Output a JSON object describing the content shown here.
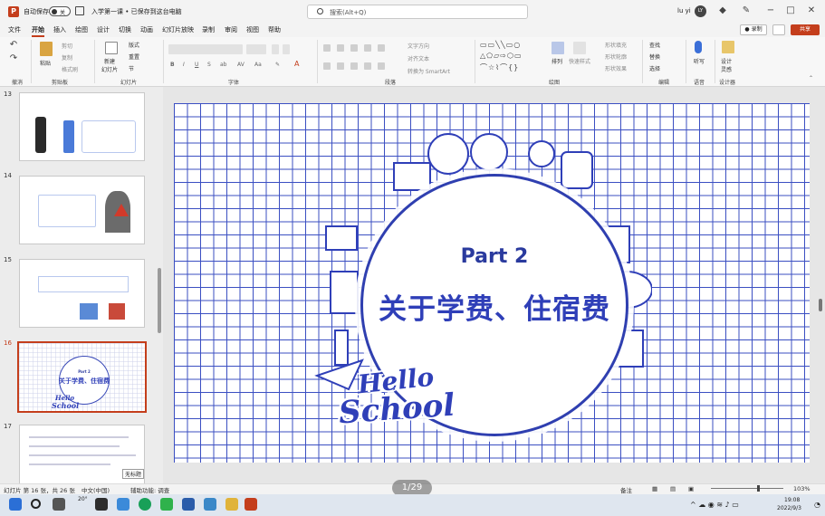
{
  "titlebar": {
    "autosave_label": "自动保存",
    "autosave_state": "关",
    "doc_title": "入学第一课 • 已保存到这台电脑",
    "search_placeholder": "搜索(Alt+Q)",
    "user_name": "lu yi",
    "user_initials": "LY"
  },
  "menu": {
    "items": [
      "文件",
      "开始",
      "插入",
      "绘图",
      "设计",
      "切换",
      "动画",
      "幻灯片放映",
      "录制",
      "审阅",
      "视图",
      "帮助"
    ],
    "active_index": 1,
    "record_label": "录制",
    "share_label": "共享"
  },
  "ribbon": {
    "groups": [
      "撤消",
      "剪贴板",
      "幻灯片",
      "字体",
      "段落",
      "绘图",
      "编辑",
      "语音",
      "设计器"
    ],
    "buttons": {
      "paste": "粘贴",
      "cut": "剪切",
      "copy": "复制",
      "format_painter": "格式刷",
      "new_slide": "新建\n幻灯片",
      "layout": "版式",
      "reset": "重置",
      "section": "节",
      "text_direction": "文字方向",
      "align_text": "对齐文本",
      "convert_smartart": "转换为 SmartArt",
      "arrange": "排列",
      "quick_styles": "快速样式",
      "shape_fill": "形状填充",
      "shape_outline": "形状轮廓",
      "shape_effects": "形状效果",
      "find": "查找",
      "replace": "替换",
      "select": "选择",
      "dictate": "听写",
      "designer": "设计\n灵感"
    }
  },
  "slides": [
    {
      "number": "13"
    },
    {
      "number": "14"
    },
    {
      "number": "15"
    },
    {
      "number": "16",
      "part": "Part 2",
      "title": "关于学费、住宿费"
    },
    {
      "number": "17",
      "tooltip": "无标题"
    }
  ],
  "current_slide": {
    "part": "Part 2",
    "title": "关于学费、住宿费",
    "hello": "Hello",
    "school": "School"
  },
  "statusbar": {
    "slide_info": "幻灯片 第 16 张，共 26 张",
    "language": "中文(中国)",
    "accessibility": "辅助功能: 调查",
    "notes": "备注",
    "zoom": "103%",
    "page_pill": "1/29"
  },
  "taskbar": {
    "weather": "20°",
    "time": "19:08",
    "date": "2022/9/3"
  }
}
